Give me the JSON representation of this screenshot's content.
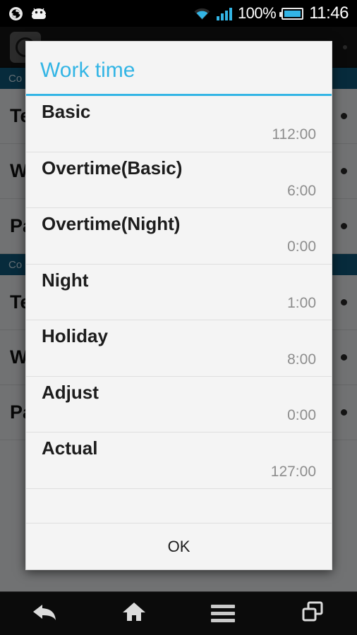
{
  "status_bar": {
    "icons": [
      "sync-icon",
      "android-icon",
      "wifi-icon",
      "signal-icon",
      "battery-icon"
    ],
    "battery_percent": "100%",
    "clock": "11:46"
  },
  "app": {
    "action_bar": {
      "app_icon": "clock-app-icon",
      "title": "",
      "overflow": "overflow-menu-icon"
    },
    "sections": [
      {
        "header": "Co",
        "rows": [
          {
            "label": "Te"
          },
          {
            "label": "W"
          },
          {
            "label": "Pa"
          }
        ]
      },
      {
        "header": "Co",
        "rows": [
          {
            "label": "Te"
          },
          {
            "label": "W"
          },
          {
            "label": "Pa"
          }
        ]
      }
    ]
  },
  "dialog": {
    "title": "Work time",
    "accent_color": "#33b5e5",
    "rows": [
      {
        "label": "Basic",
        "value": "112:00"
      },
      {
        "label": "Overtime(Basic)",
        "value": "6:00"
      },
      {
        "label": "Overtime(Night)",
        "value": "0:00"
      },
      {
        "label": "Night",
        "value": "1:00"
      },
      {
        "label": "Holiday",
        "value": "8:00"
      },
      {
        "label": "Adjust",
        "value": "0:00"
      },
      {
        "label": "Actual",
        "value": "127:00"
      }
    ],
    "ok_label": "OK"
  },
  "nav_bar": {
    "buttons": [
      {
        "name": "back-icon"
      },
      {
        "name": "home-icon"
      },
      {
        "name": "menu-icon"
      },
      {
        "name": "recents-icon"
      }
    ]
  }
}
